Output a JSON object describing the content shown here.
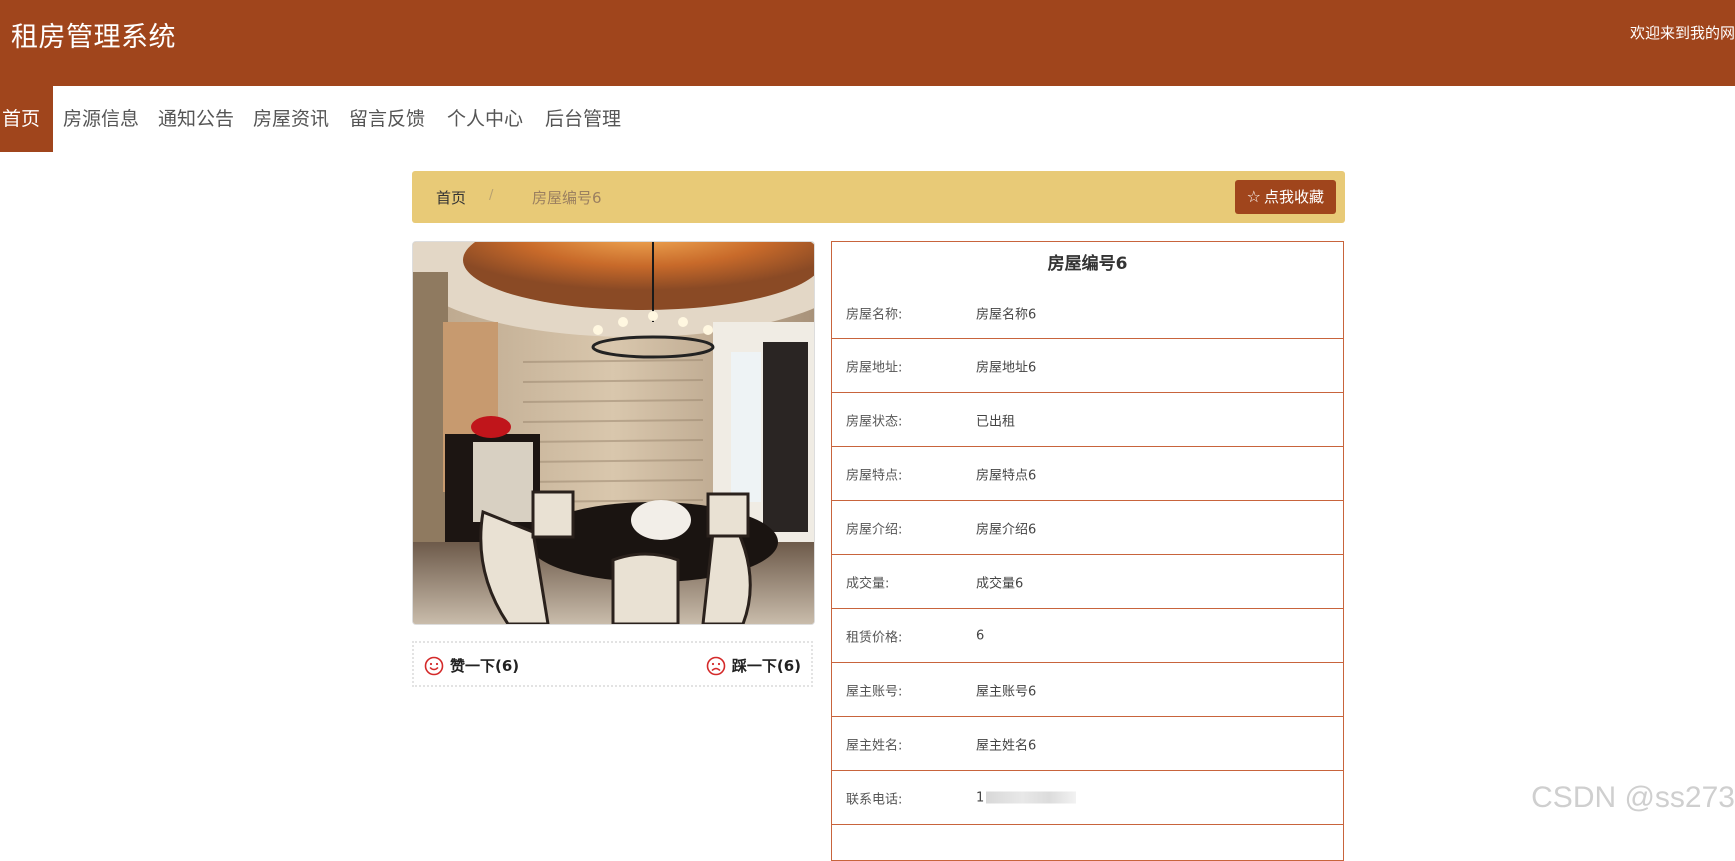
{
  "header": {
    "title": "租房管理系统",
    "welcome": "欢迎来到我的网"
  },
  "nav": {
    "items": [
      {
        "label": "首页",
        "active": true
      },
      {
        "label": "房源信息"
      },
      {
        "label": "通知公告"
      },
      {
        "label": "房屋资讯"
      },
      {
        "label": "留言反馈"
      },
      {
        "label": "个人中心"
      },
      {
        "label": "后台管理"
      }
    ]
  },
  "breadcrumb": {
    "home": "首页",
    "separator": "/",
    "current": "房屋编号6"
  },
  "favorite_button": "点我收藏",
  "votes": {
    "like": "赞一下(6)",
    "dislike": "踩一下(6)"
  },
  "detail": {
    "title": "房屋编号6",
    "rows": [
      {
        "key": "房屋名称:",
        "value": "房屋名称6"
      },
      {
        "key": "房屋地址:",
        "value": "房屋地址6"
      },
      {
        "key": "房屋状态:",
        "value": "已出租"
      },
      {
        "key": "房屋特点:",
        "value": "房屋特点6"
      },
      {
        "key": "房屋介绍:",
        "value": "房屋介绍6"
      },
      {
        "key": "成交量:",
        "value": "成交量6"
      },
      {
        "key": "租赁价格:",
        "value": "6"
      },
      {
        "key": "屋主账号:",
        "value": "屋主账号6"
      },
      {
        "key": "屋主姓名:",
        "value": "屋主姓名6"
      },
      {
        "key": "联系电话:",
        "value": "1"
      }
    ]
  },
  "watermark": "CSDN @ss273",
  "colors": {
    "primary": "#a0451c",
    "breadcrumb_bg": "#e8ca77",
    "border": "#c8643c"
  }
}
